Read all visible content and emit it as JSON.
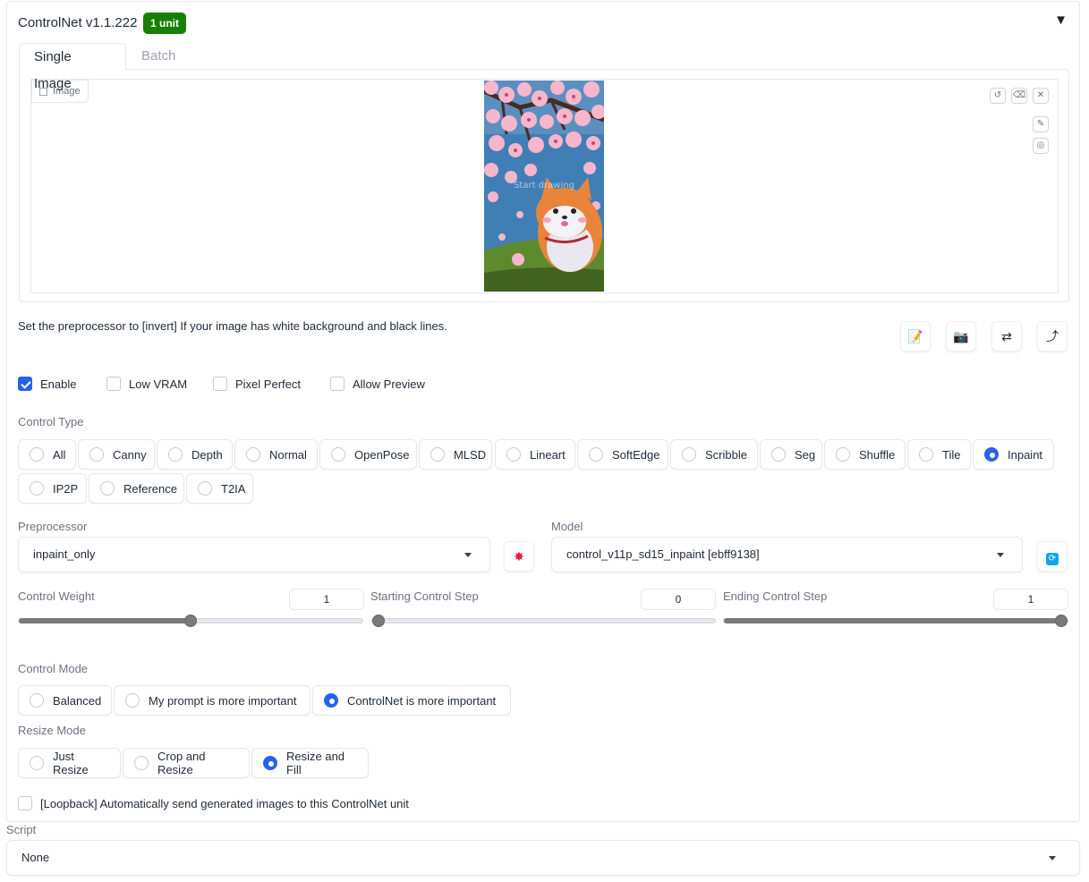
{
  "header": {
    "title": "ControlNet v1.1.222",
    "badge": "1 unit"
  },
  "tabs": [
    {
      "label": "Single Image"
    },
    {
      "label": "Batch"
    }
  ],
  "image_panel": {
    "label": "Image",
    "canvas_text": "Start drawing"
  },
  "help_text": "Set the preprocessor to [invert] If your image has white background and black lines.",
  "checkboxes": [
    {
      "label": "Enable",
      "checked": true
    },
    {
      "label": "Low VRAM",
      "checked": false
    },
    {
      "label": "Pixel Perfect",
      "checked": false
    },
    {
      "label": "Allow Preview",
      "checked": false
    }
  ],
  "control_type": {
    "label": "Control Type",
    "options": [
      "All",
      "Canny",
      "Depth",
      "Normal",
      "OpenPose",
      "MLSD",
      "Lineart",
      "SoftEdge",
      "Scribble",
      "Seg",
      "Shuffle",
      "Tile",
      "Inpaint",
      "IP2P",
      "Reference",
      "T2IA"
    ],
    "selected": "Inpaint"
  },
  "preprocessor": {
    "label": "Preprocessor",
    "value": "inpaint_only"
  },
  "model": {
    "label": "Model",
    "value": "control_v11p_sd15_inpaint [ebff9138]"
  },
  "sliders": [
    {
      "label": "Control Weight",
      "value": "1",
      "fraction": 0.5
    },
    {
      "label": "Starting Control Step",
      "value": "0",
      "fraction": 0.0
    },
    {
      "label": "Ending Control Step",
      "value": "1",
      "fraction": 1.0
    }
  ],
  "control_mode": {
    "label": "Control Mode",
    "options": [
      "Balanced",
      "My prompt is more important",
      "ControlNet is more important"
    ],
    "selected": "ControlNet is more important"
  },
  "resize_mode": {
    "label": "Resize Mode",
    "options": [
      "Just Resize",
      "Crop and Resize",
      "Resize and Fill"
    ],
    "selected": "Resize and Fill"
  },
  "loopback": {
    "label": "[Loopback] Automatically send generated images to this ControlNet unit",
    "checked": false
  },
  "script": {
    "label": "Script",
    "value": "None"
  },
  "colors": {
    "accent": "#2563eb",
    "badge": "#168000"
  }
}
